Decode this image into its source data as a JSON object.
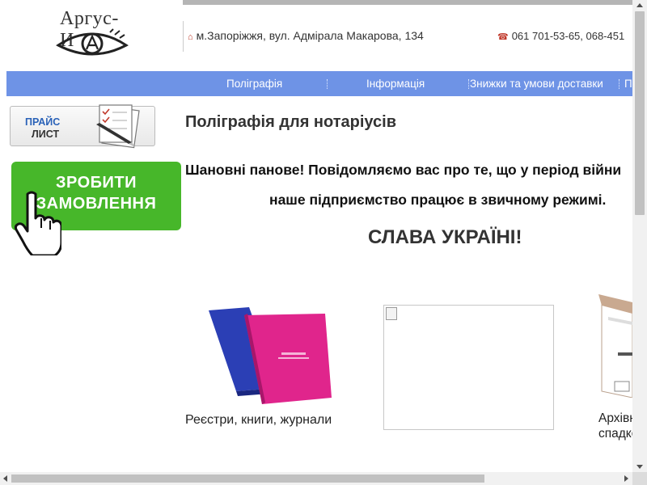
{
  "header": {
    "logo_text": "Аргус-И",
    "address": "м.Запоріжжя, вул. Адмірала Макарова, 134",
    "phone": "061 701-53-65, 068-451"
  },
  "nav": {
    "items": [
      {
        "label": "Поліграфія"
      },
      {
        "label": "Інформація"
      },
      {
        "label": "Знижки та умови доставки"
      },
      {
        "label": "П"
      }
    ]
  },
  "sidebar": {
    "price_line1": "ПРАЙС",
    "price_line2": "ЛИСТ",
    "order_line1": "ЗРОБИТИ",
    "order_line2": "ЗАМОВЛЕННЯ"
  },
  "main": {
    "title": "Поліграфія для нотаріусів",
    "notice_line1": "Шановні панове! Повідомляємо вас про те, що у період війни",
    "notice_line2": "наше підприємство працює в звичному режимі.",
    "slogan": "СЛАВА УКРАЇНІ!",
    "products": [
      {
        "caption": "Реєстри, книги, журнали"
      },
      {
        "caption": ""
      },
      {
        "caption_line1": "Архівні",
        "caption_line2": "спадкові"
      }
    ]
  },
  "colors": {
    "nav_bg": "#6e93e6",
    "order_btn": "#47b72a",
    "accent_icon": "#c0392b"
  }
}
